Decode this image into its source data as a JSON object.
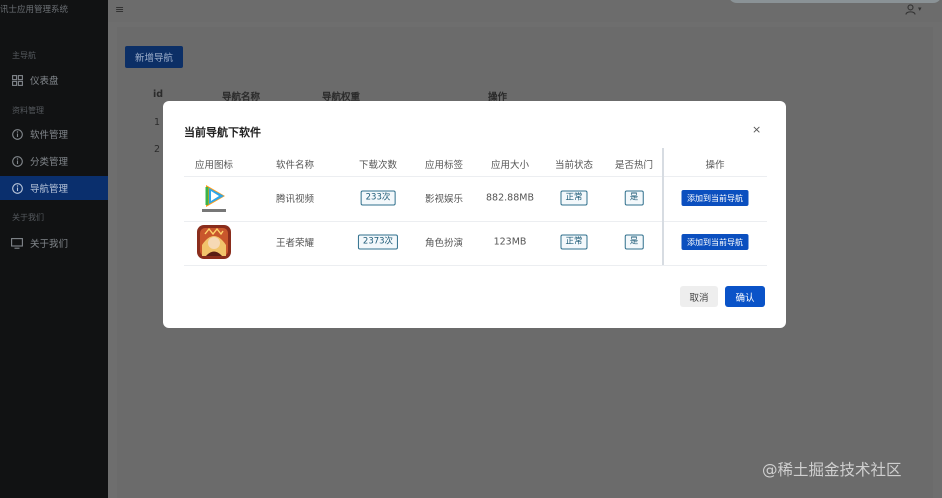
{
  "app": {
    "title": "讯士应用管理系统"
  },
  "sidebar": {
    "group_home": "主导航",
    "dashboard": "仪表盘",
    "group_data": "资料管理",
    "items": [
      {
        "label": "软件管理",
        "icon": "info-circle-icon"
      },
      {
        "label": "分类管理",
        "icon": "info-circle-icon"
      },
      {
        "label": "导航管理",
        "icon": "info-circle-icon",
        "active": true
      }
    ],
    "group_about": "关于我们",
    "about": "关于我们"
  },
  "topbar": {
    "menu_icon": "hamburger-icon",
    "user_icon": "user-icon"
  },
  "page": {
    "new_nav_button": "新增导航",
    "columns": {
      "id": "id",
      "name": "导航名称",
      "key": "导航权重",
      "ops": "操作"
    },
    "row_ids": [
      "1",
      "2"
    ]
  },
  "modal": {
    "title": "当前导航下软件",
    "close": "×",
    "headers": {
      "icon": "应用图标",
      "name": "软件名称",
      "downloads": "下载次数",
      "tag": "应用标签",
      "size": "应用大小",
      "status": "当前状态",
      "hot": "是否热门",
      "ops": "操作"
    },
    "rows": [
      {
        "name": "腾讯视频",
        "downloads": "233次",
        "tag": "影视娱乐",
        "size": "882.88MB",
        "status": "正常",
        "hot": "是",
        "action": "添加到当前导航",
        "icon": "tencent-video-icon"
      },
      {
        "name": "王者荣耀",
        "downloads": "2373次",
        "tag": "角色扮演",
        "size": "123MB",
        "status": "正常",
        "hot": "是",
        "action": "添加到当前导航",
        "icon": "honor-of-kings-icon"
      }
    ],
    "cancel": "取消",
    "confirm": "确认"
  },
  "watermark": "@稀土掘金技术社区",
  "colors": {
    "primary": "#0a53c8",
    "sidebar_bg": "#111213",
    "active_item": "#0a2f6d",
    "tag_border": "#2f6f8c"
  }
}
